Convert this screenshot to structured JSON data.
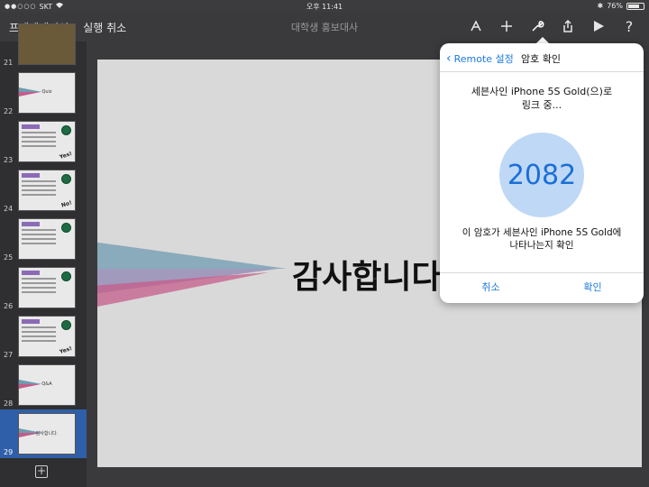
{
  "status_bar": {
    "carrier": "SKT",
    "time": "오후 11:41",
    "battery_text": "76%",
    "battery_level": 0.76
  },
  "toolbar": {
    "presentations_label": "프레젠테이션",
    "undo_label": "실행 취소",
    "document_title": "대학생 홍보대사",
    "icons": [
      "format-icon",
      "add-icon",
      "wrench-icon",
      "share-icon",
      "play-icon",
      "help-icon"
    ],
    "help_label": "?"
  },
  "sidebar": {
    "slides": [
      {
        "number": "21",
        "kind": "photo"
      },
      {
        "number": "22",
        "kind": "title",
        "text": "Quiz"
      },
      {
        "number": "23",
        "kind": "question",
        "tag": "Question",
        "stamp": "Yes!"
      },
      {
        "number": "24",
        "kind": "question",
        "tag": "Question",
        "stamp": "No!"
      },
      {
        "number": "25",
        "kind": "question",
        "tag": "Question",
        "stamp": ""
      },
      {
        "number": "26",
        "kind": "question",
        "tag": "Question",
        "stamp": ""
      },
      {
        "number": "27",
        "kind": "question",
        "tag": "Question",
        "stamp": "Yes!"
      },
      {
        "number": "28",
        "kind": "title",
        "text": "Q&A"
      },
      {
        "number": "29",
        "kind": "title",
        "text": "감사합니다.",
        "selected": true
      }
    ],
    "add_slide_label": "+"
  },
  "slide": {
    "title": "감사합니다"
  },
  "popover": {
    "back_label": "Remote 설정",
    "title": "암호 확인",
    "message_line1": "세븐사인 iPhone 5S Gold(으)로",
    "message_line2": "링크 중...",
    "code": "2082",
    "confirm_line1": "이 암호가 세븐사인 iPhone 5S Gold에",
    "confirm_line2": "나타나는지 확인",
    "cancel_label": "취소",
    "ok_label": "확인"
  },
  "colors": {
    "accent": "#1f7ae0",
    "selection": "#2f5fa8",
    "code_circle": "#bfd8f6"
  }
}
